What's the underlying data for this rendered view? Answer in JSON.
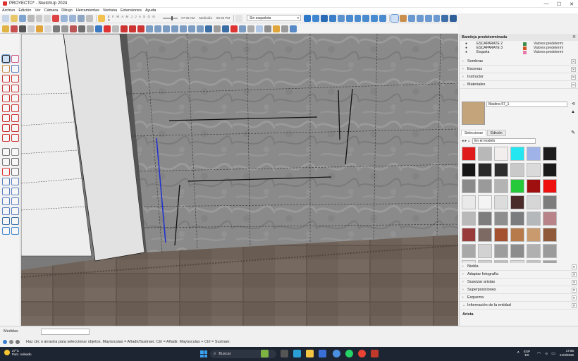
{
  "window": {
    "title": "PROYECTO* - SketchUp 2024",
    "controls": [
      "—",
      "☐",
      "✕"
    ]
  },
  "menu": [
    "Archivo",
    "Edición",
    "Ver",
    "Cámara",
    "Dibujo",
    "Herramientas",
    "Ventana",
    "Extensiones",
    "Ayuda"
  ],
  "shadows": {
    "months": "E F M A M J J A S O N D",
    "time_start": "07:35 AM",
    "time_mid": "Mediodía",
    "time_end": "05:33 PM"
  },
  "style_select": {
    "value": "Sin esqueleta"
  },
  "tray": {
    "title": "Bandeja predeterminada",
    "layers": [
      {
        "name": "ESCAPARATE 2",
        "color": "#3d8d4a",
        "desc": "Valores predetermi"
      },
      {
        "name": "ESCAPARATE 3",
        "color": "#d2551f",
        "desc": "Valores predetermi"
      },
      {
        "name": "Esqueta",
        "color": "#e679a8",
        "desc": "Valores predetermi"
      }
    ],
    "panels_top": [
      "Sombras",
      "Escenas",
      "Instructor"
    ],
    "materials_label": "Materiales",
    "material_name": "Madera 57_1",
    "tabs": [
      "Seleccionar",
      "Edición"
    ],
    "collection": "En el modelo",
    "panels_bottom": [
      "Niebla",
      "Adaptar fotografía",
      "Suavizar aristas",
      "Superposiciones",
      "Esquema",
      "Información de la entidad"
    ],
    "entity_label": "Arista"
  },
  "swatches": [
    "#e01b1b",
    "#b8b8b8",
    "#f3eeee",
    "#23e6f0",
    "#9fb3e8",
    "#1c1c1c",
    "#161616",
    "#2a2a2a",
    "#2d2d2d",
    "#c9c9c9",
    "#dadada",
    "#1a1a1a",
    "#8a8a8a",
    "#9a9a9a",
    "#b3b3b3",
    "#26c93a",
    "#a00f0f",
    "#ee0f0f",
    "#e9e9e9",
    "#f4f4f4",
    "#dcdcdc",
    "#4b2a2a",
    "#d6d6d6",
    "#7c7c7c",
    "#b9b9b9",
    "#7d7d7d",
    "#8e8e8e",
    "#7a7c7e",
    "#b4b8bb",
    "#b8848a",
    "#9a3b3b",
    "#7d6a63",
    "#a5502f",
    "#b77a4b",
    "#c99a6d",
    "#8f5a3a",
    "#a8a8a8",
    "#d2d2d2",
    "#9d9d9d",
    "#8c8c8c",
    "#b0b0b0",
    "#9b9b9b",
    "#e6e6e6",
    "#cfcfcf",
    "#bfbfbf",
    "#d8d8d8",
    "#c4c4c4",
    "#a3a3a3"
  ],
  "material_preview_color": "#c4a47a",
  "measure": {
    "label": "Medidas",
    "value": ""
  },
  "status": {
    "text": "Haz clic o arrastra para seleccionar objetos. Mayúsculas = Añadir/Sustraer. Ctrl = Añadir. Mayúsculas + Ctrl = Sustraer."
  },
  "taskbar": {
    "temp": "27°C",
    "weather": "Parc. soleado",
    "search": "Buscar",
    "lang1": "ESP",
    "lang2": "ES",
    "time": "17:56",
    "date": "21/3/2026"
  }
}
